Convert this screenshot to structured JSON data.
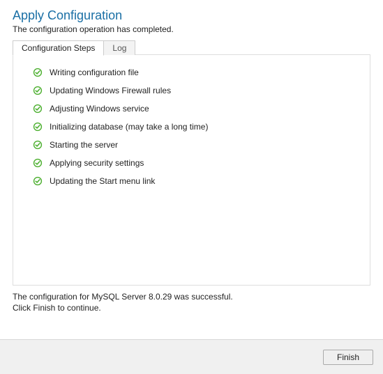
{
  "header": {
    "title": "Apply Configuration",
    "subtitle": "The configuration operation has completed."
  },
  "tabs": {
    "items": [
      {
        "label": "Configuration Steps",
        "active": true
      },
      {
        "label": "Log",
        "active": false
      }
    ]
  },
  "steps": [
    {
      "label": "Writing configuration file",
      "status": "success"
    },
    {
      "label": "Updating Windows Firewall rules",
      "status": "success"
    },
    {
      "label": "Adjusting Windows service",
      "status": "success"
    },
    {
      "label": "Initializing database (may take a long time)",
      "status": "success"
    },
    {
      "label": "Starting the server",
      "status": "success"
    },
    {
      "label": "Applying security settings",
      "status": "success"
    },
    {
      "label": "Updating the Start menu link",
      "status": "success"
    }
  ],
  "status": {
    "line1": "The configuration for MySQL Server 8.0.29 was successful.",
    "line2": "Click Finish to continue."
  },
  "footer": {
    "finish_label": "Finish"
  },
  "colors": {
    "title": "#1a6fa5",
    "check": "#4caf2f"
  }
}
